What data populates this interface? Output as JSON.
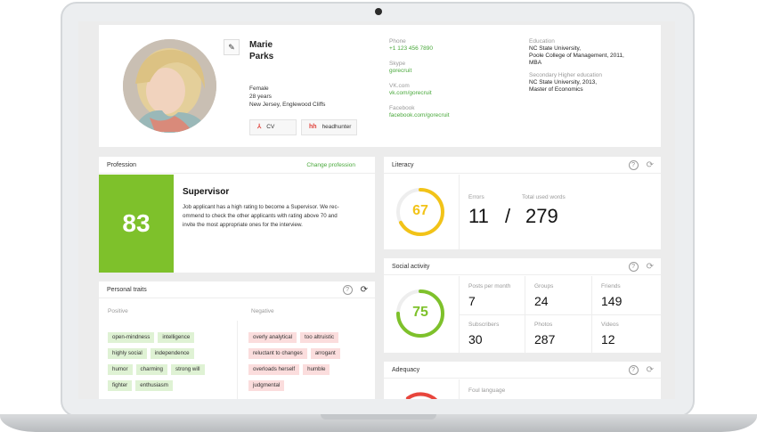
{
  "profile": {
    "first_name": "Marie",
    "last_name": "Parks",
    "gender": "Female",
    "age": "28 years",
    "location": "New Jersey, Englewood Cliffs",
    "cv_label": "CV",
    "headhunter_label": "headhunter",
    "phone_label": "Phone",
    "phone": "+1 123 456 7890",
    "skype_label": "Skype",
    "skype": "gorecruit",
    "vk_label": "VK.com",
    "vk": "vk.com/gorecruit",
    "facebook_label": "Facebook",
    "facebook": "facebook.com/gorecruit",
    "education_label": "Education",
    "education_1": "NC State University,",
    "education_2": "Poole College of Management, 2011,",
    "education_3": "MBA",
    "secondary_label": "Secondary Higher education",
    "secondary_1": "NC State University, 2013,",
    "secondary_2": "Master of Economics"
  },
  "profession": {
    "header": "Profession",
    "change_link": "Change profession",
    "score": "83",
    "score_color": "#7ec12b",
    "title": "Supervisor",
    "text_1": "Job applicant has a high rating to become a Supervisor. We rec-",
    "text_2": "ommend to check the other applicants with rating above 70 and",
    "text_3": "invite the most appropriate ones for the interview."
  },
  "traits": {
    "header": "Personal traits",
    "positive_label": "Positive",
    "negative_label": "Negative",
    "positive": [
      "open-mindness",
      "intelligence",
      "highly social",
      "independence",
      "humor",
      "charming",
      "strong will",
      "fighter",
      "enthusiasm"
    ],
    "negative": [
      "overly analytical",
      "too altruistic",
      "reluctant to changes",
      "arrogant",
      "overloads herself",
      "humble",
      "judgmental"
    ]
  },
  "literacy": {
    "header": "Literacy",
    "score": "67",
    "score_fraction": 0.67,
    "ring_color": "#f2c318",
    "errors_label": "Errors",
    "errors": "11",
    "separator": "/",
    "words_label": "Total used words",
    "words": "279"
  },
  "social": {
    "header": "Social activity",
    "score": "75",
    "score_fraction": 0.75,
    "ring_color": "#7ec12b",
    "posts_label": "Posts per month",
    "posts": "7",
    "groups_label": "Groups",
    "groups": "24",
    "friends_label": "Friends",
    "friends": "149",
    "subscribers_label": "Subscribers",
    "subscribers": "30",
    "photos_label": "Photos",
    "photos": "287",
    "videos_label": "Videos",
    "videos": "12"
  },
  "adequacy": {
    "header": "Adequacy",
    "foul_label": "Foul language",
    "ring_color": "#e8453c"
  },
  "icons": {
    "edit": "pencil-icon",
    "cv": "pdf-icon",
    "headhunter": "hh-icon",
    "help": "help-icon",
    "refresh": "refresh-icon"
  }
}
